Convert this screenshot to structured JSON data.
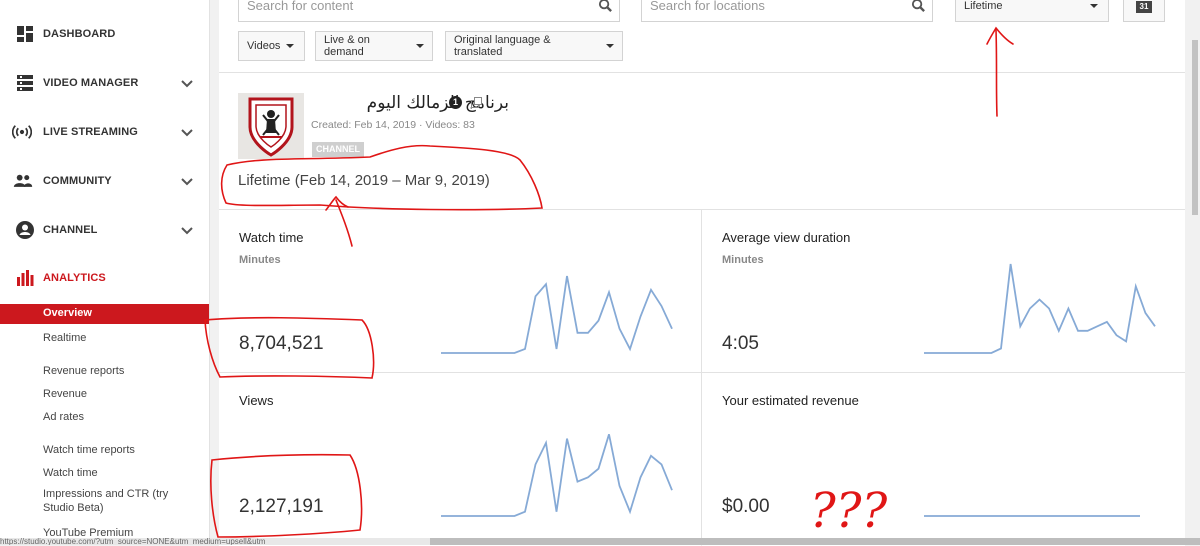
{
  "sidebar": {
    "nav": [
      {
        "label": "DASHBOARD",
        "icon": "dashboard-icon"
      },
      {
        "label": "VIDEO MANAGER",
        "icon": "video-manager-icon"
      },
      {
        "label": "LIVE STREAMING",
        "icon": "live-streaming-icon"
      },
      {
        "label": "COMMUNITY",
        "icon": "community-icon"
      },
      {
        "label": "CHANNEL",
        "icon": "channel-icon"
      },
      {
        "label": "ANALYTICS",
        "icon": "analytics-icon"
      }
    ],
    "sub": {
      "overview": "Overview",
      "realtime": "Realtime",
      "revenue_reports": "Revenue reports",
      "revenue": "Revenue",
      "ad_rates": "Ad rates",
      "watch_time_reports": "Watch time reports",
      "watch_time": "Watch time",
      "impressions": "Impressions and CTR (try Studio Beta)",
      "youtube_premium": "YouTube Premium"
    },
    "accent_color": "#cc181e"
  },
  "toolbar": {
    "search_content_placeholder": "Search for content",
    "search_locations_placeholder": "Search for locations",
    "date_range": "Lifetime",
    "calendar_day": "31",
    "filters": [
      "Videos",
      "Live & on demand",
      "Original language & translated"
    ]
  },
  "channel": {
    "name": "برنامج الزمالك اليوم",
    "badge": "1",
    "created": "Created: Feb 14, 2019",
    "videos": "Videos: 83",
    "type_tag": "CHANNEL",
    "period": "Lifetime (Feb 14, 2019 – Mar 9, 2019)"
  },
  "metrics": {
    "watch_time": {
      "title": "Watch time",
      "unit": "Minutes",
      "value": "8,704,521"
    },
    "avg_view_duration": {
      "title": "Average view duration",
      "unit": "Minutes",
      "value": "4:05"
    },
    "views": {
      "title": "Views",
      "value": "2,127,191"
    },
    "revenue": {
      "title": "Your estimated revenue",
      "value": "$0.00"
    }
  },
  "chart_data": [
    {
      "type": "line",
      "name": "watch-time-sparkline",
      "values": [
        0,
        0,
        0,
        0,
        0,
        0,
        0,
        0,
        0.05,
        0.7,
        0.85,
        0.05,
        0.95,
        0.25,
        0.25,
        0.4,
        0.75,
        0.3,
        0.05,
        0.45,
        0.78,
        0.58,
        0.3
      ],
      "color": "#86aad6"
    },
    {
      "type": "line",
      "name": "avg-view-duration-sparkline",
      "values": [
        0,
        0,
        0,
        0,
        0,
        0,
        0,
        0,
        0.05,
        1.0,
        0.3,
        0.5,
        0.6,
        0.5,
        0.25,
        0.5,
        0.25,
        0.25,
        0.3,
        0.35,
        0.2,
        0.13,
        0.75,
        0.45,
        0.3
      ],
      "color": "#86aad6"
    },
    {
      "type": "line",
      "name": "views-sparkline",
      "values": [
        0,
        0,
        0,
        0,
        0,
        0,
        0,
        0,
        0.05,
        0.6,
        0.85,
        0.05,
        0.9,
        0.4,
        0.45,
        0.55,
        0.95,
        0.35,
        0.05,
        0.45,
        0.7,
        0.6,
        0.3
      ],
      "color": "#86aad6"
    },
    {
      "type": "line",
      "name": "revenue-sparkline",
      "values": [
        0,
        0,
        0,
        0,
        0,
        0,
        0,
        0,
        0,
        0,
        0,
        0,
        0,
        0,
        0,
        0,
        0,
        0,
        0,
        0
      ],
      "color": "#86aad6"
    }
  ],
  "annotations": {
    "question_marks": "???",
    "color": "#e01616"
  },
  "status_url": "https://studio.youtube.com/?utm_source=NONE&utm_medium=upsell&utm_"
}
